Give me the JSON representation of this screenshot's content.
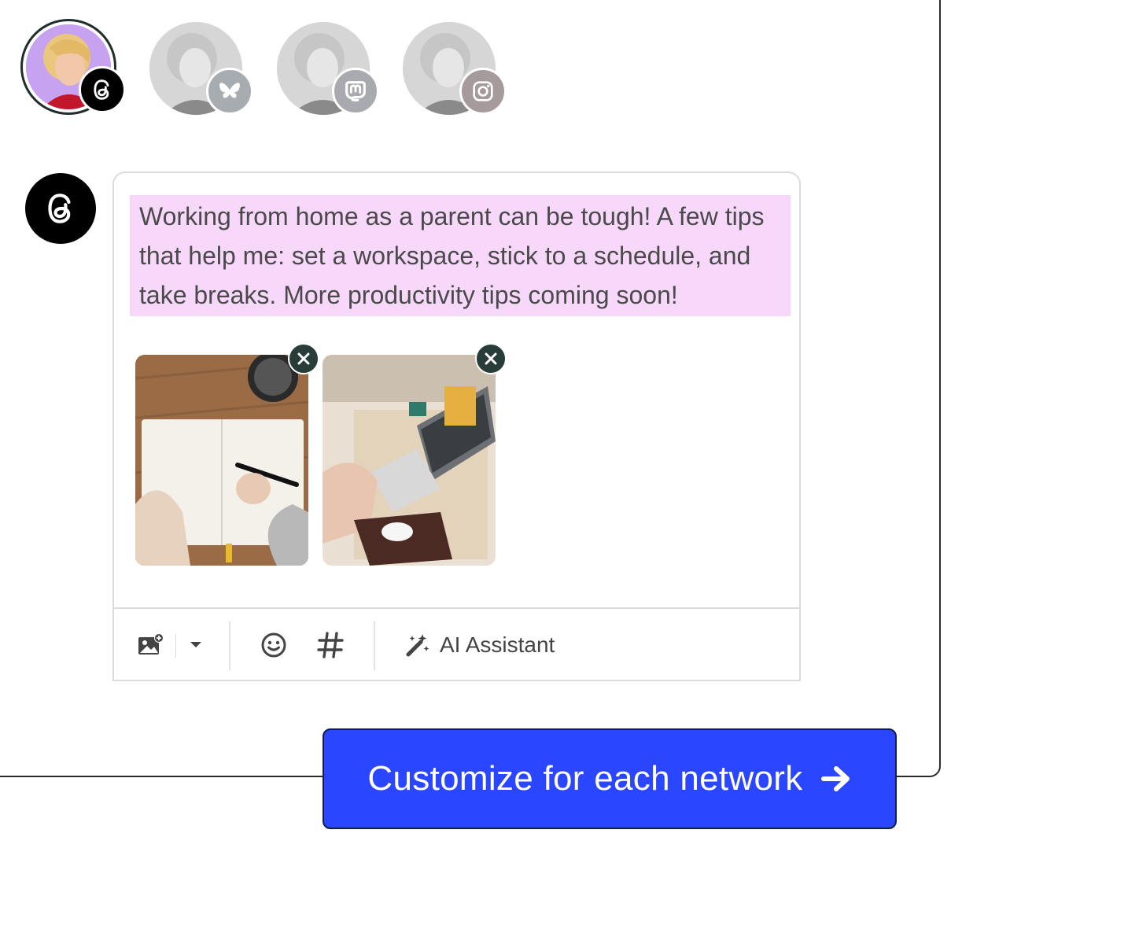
{
  "profiles": [
    {
      "name": "threads-profile",
      "network": "threads",
      "selected": true,
      "badge_icon": "threads-icon",
      "badge_color": "#000000"
    },
    {
      "name": "bluesky-profile",
      "network": "bluesky",
      "selected": false,
      "badge_icon": "butterfly-icon",
      "badge_color": "#a6acb0"
    },
    {
      "name": "mastodon-profile",
      "network": "mastodon",
      "selected": false,
      "badge_icon": "mastodon-icon",
      "badge_color": "#a9a9b0"
    },
    {
      "name": "instagram-profile",
      "network": "instagram",
      "selected": false,
      "badge_icon": "instagram-icon",
      "badge_color": "#a59a9c"
    }
  ],
  "composer": {
    "network_icon": "threads-icon",
    "text": "Working from home as a parent can be tough! A few tips that help me: set a workspace, stick to a schedule, and take breaks. More productivity tips coming soon!",
    "highlight_color": "#f7d8fb",
    "attachments": [
      {
        "name": "notebook-photo",
        "remove_icon": "close-icon"
      },
      {
        "name": "laptop-desk-photo",
        "remove_icon": "close-icon"
      }
    ]
  },
  "toolbar": {
    "media_icon": "add-image-icon",
    "dropdown_icon": "caret-down-icon",
    "emoji_icon": "smiley-icon",
    "hashtag_icon": "hashtag-icon",
    "ai_icon": "magic-wand-icon",
    "ai_label": "AI Assistant"
  },
  "cta": {
    "label": "Customize for each network",
    "icon": "arrow-right-icon",
    "color": "#2b46ff"
  }
}
